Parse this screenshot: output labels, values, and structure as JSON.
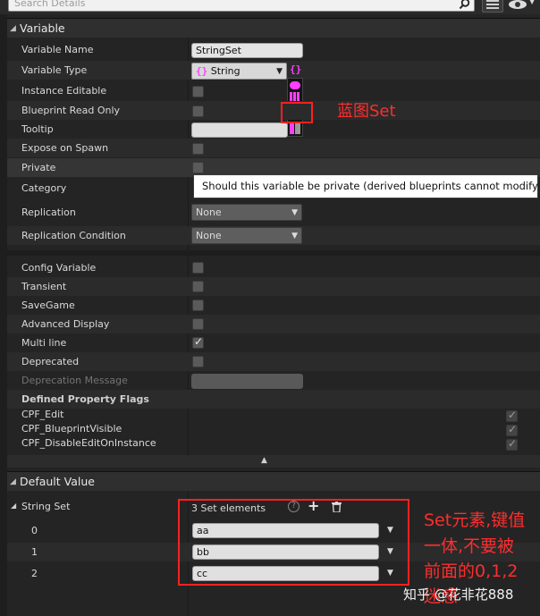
{
  "search": {
    "placeholder": "Search Details"
  },
  "sections": {
    "variable": {
      "title": "Variable"
    },
    "default_value": {
      "title": "Default Value"
    }
  },
  "properties": {
    "variable_name": {
      "label": "Variable Name",
      "value": "StringSet"
    },
    "variable_type": {
      "label": "Variable Type",
      "value": "String"
    },
    "instance_editable": {
      "label": "Instance Editable",
      "checked": false
    },
    "blueprint_read_only": {
      "label": "Blueprint Read Only",
      "checked": false
    },
    "tooltip": {
      "label": "Tooltip",
      "value": ""
    },
    "expose_on_spawn": {
      "label": "Expose on Spawn",
      "checked": false
    },
    "private": {
      "label": "Private",
      "checked": false
    },
    "category": {
      "label": "Category"
    },
    "replication": {
      "label": "Replication",
      "value": "None"
    },
    "replication_condition": {
      "label": "Replication Condition",
      "value": "None"
    },
    "config_variable": {
      "label": "Config Variable",
      "checked": false
    },
    "transient": {
      "label": "Transient",
      "checked": false
    },
    "savegame": {
      "label": "SaveGame",
      "checked": false
    },
    "advanced_display": {
      "label": "Advanced Display",
      "checked": false
    },
    "multi_line": {
      "label": "Multi line",
      "checked": true
    },
    "deprecated": {
      "label": "Deprecated",
      "checked": false
    },
    "deprecation_message": {
      "label": "Deprecation Message",
      "value": ""
    },
    "defined_flags": {
      "label": "Defined Property Flags"
    },
    "cpf_edit": {
      "label": "CPF_Edit",
      "checked": true
    },
    "cpf_blueprint_visible": {
      "label": "CPF_BlueprintVisible",
      "checked": true
    },
    "cpf_disable_edit_on_instance": {
      "label": "CPF_DisableEditOnInstance",
      "checked": true
    }
  },
  "tooltip_popup": {
    "text": "Should this variable be private (derived blueprints cannot modify it)?"
  },
  "set_glyph": "{}",
  "check_glyph": "✓",
  "default_value": {
    "label": "String Set",
    "count_text": "3 Set elements",
    "elements": [
      {
        "index": "0",
        "value": "aa"
      },
      {
        "index": "1",
        "value": "bb"
      },
      {
        "index": "2",
        "value": "cc"
      }
    ]
  },
  "annotations": {
    "blueprint_set": "蓝图Set",
    "set_note_lines": [
      "Set元素,键值",
      "一体,不要被",
      "前面的0,1,2",
      "迷惑"
    ]
  },
  "watermark": "知乎 @花非花888",
  "colors": {
    "set_pink": "#ff3fff",
    "annotation_red": "#ff2020",
    "panel_bg": "#242424"
  }
}
